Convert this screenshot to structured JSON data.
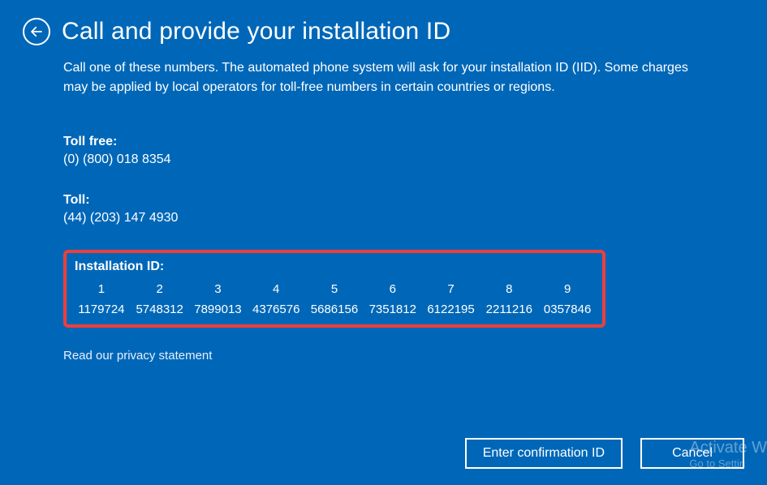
{
  "header": {
    "title": "Call and provide your installation ID"
  },
  "intro": "Call one of these numbers. The automated phone system will ask for your installation ID (IID). Some charges may be applied by local operators for toll-free numbers in certain countries or regions.",
  "phones": {
    "tollfree_label": "Toll free:",
    "tollfree_number": "(0) (800) 018 8354",
    "toll_label": "Toll:",
    "toll_number": "(44) (203) 147 4930"
  },
  "installation_id": {
    "label": "Installation ID:",
    "headers": [
      "1",
      "2",
      "3",
      "4",
      "5",
      "6",
      "7",
      "8",
      "9"
    ],
    "values": [
      "1179724",
      "5748312",
      "7899013",
      "4376576",
      "5686156",
      "7351812",
      "6122195",
      "2211216",
      "0357846"
    ]
  },
  "privacy_link": "Read our privacy statement",
  "buttons": {
    "enter_confirmation": "Enter confirmation ID",
    "cancel": "Cancel"
  },
  "watermark": {
    "line1": "Activate W",
    "line2": "Go to Settin"
  }
}
